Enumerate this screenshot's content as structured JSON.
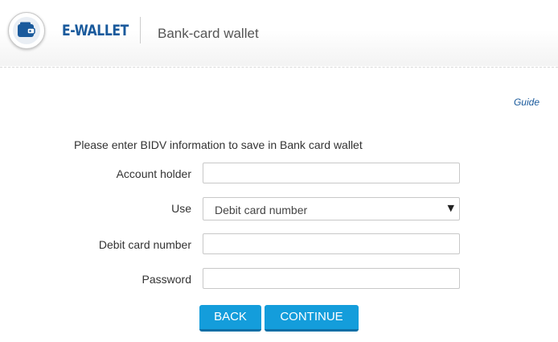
{
  "header": {
    "brand": "E-WALLET",
    "subtitle": "Bank-card wallet",
    "logo_icon": "wallet-icon"
  },
  "guide_link": "Guide",
  "form": {
    "intro": "Please enter BIDV information to save in Bank card wallet",
    "account_holder": {
      "label": "Account holder",
      "value": ""
    },
    "use": {
      "label": "Use",
      "selected": "Debit card number"
    },
    "debit_card_number": {
      "label": "Debit card number",
      "value": ""
    },
    "password": {
      "label": "Password",
      "value": ""
    }
  },
  "buttons": {
    "back": "BACK",
    "continue": "CONTINUE"
  },
  "colors": {
    "brand": "#1a5a9c",
    "button": "#149ddb",
    "button_shadow": "#0b6fa6"
  }
}
